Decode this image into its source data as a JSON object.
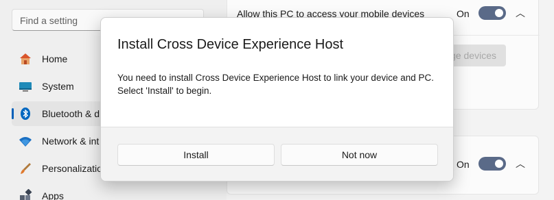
{
  "search": {
    "placeholder": "Find a setting"
  },
  "sidebar": {
    "items": [
      {
        "label": "Home",
        "icon": "home-icon"
      },
      {
        "label": "System",
        "icon": "system-icon"
      },
      {
        "label": "Bluetooth & d",
        "icon": "bluetooth-icon",
        "selected": true
      },
      {
        "label": "Network & int",
        "icon": "wifi-icon"
      },
      {
        "label": "Personalization",
        "icon": "brush-icon"
      },
      {
        "label": "Apps",
        "icon": "apps-icon"
      }
    ]
  },
  "content": {
    "card1_text": "Allow this PC to access your mobile devices",
    "card1_toggle": "On",
    "card1_button": "ge devices",
    "card2_toggle": "On"
  },
  "dialog": {
    "title": "Install Cross Device Experience Host",
    "body_line1": "You need to install Cross Device Experience Host to link your device and PC.",
    "body_line2": "Select 'Install' to begin.",
    "install_label": "Install",
    "not_now_label": "Not now"
  },
  "colors": {
    "accent": "#005fb8",
    "toggle_on": "#5a6a88"
  }
}
